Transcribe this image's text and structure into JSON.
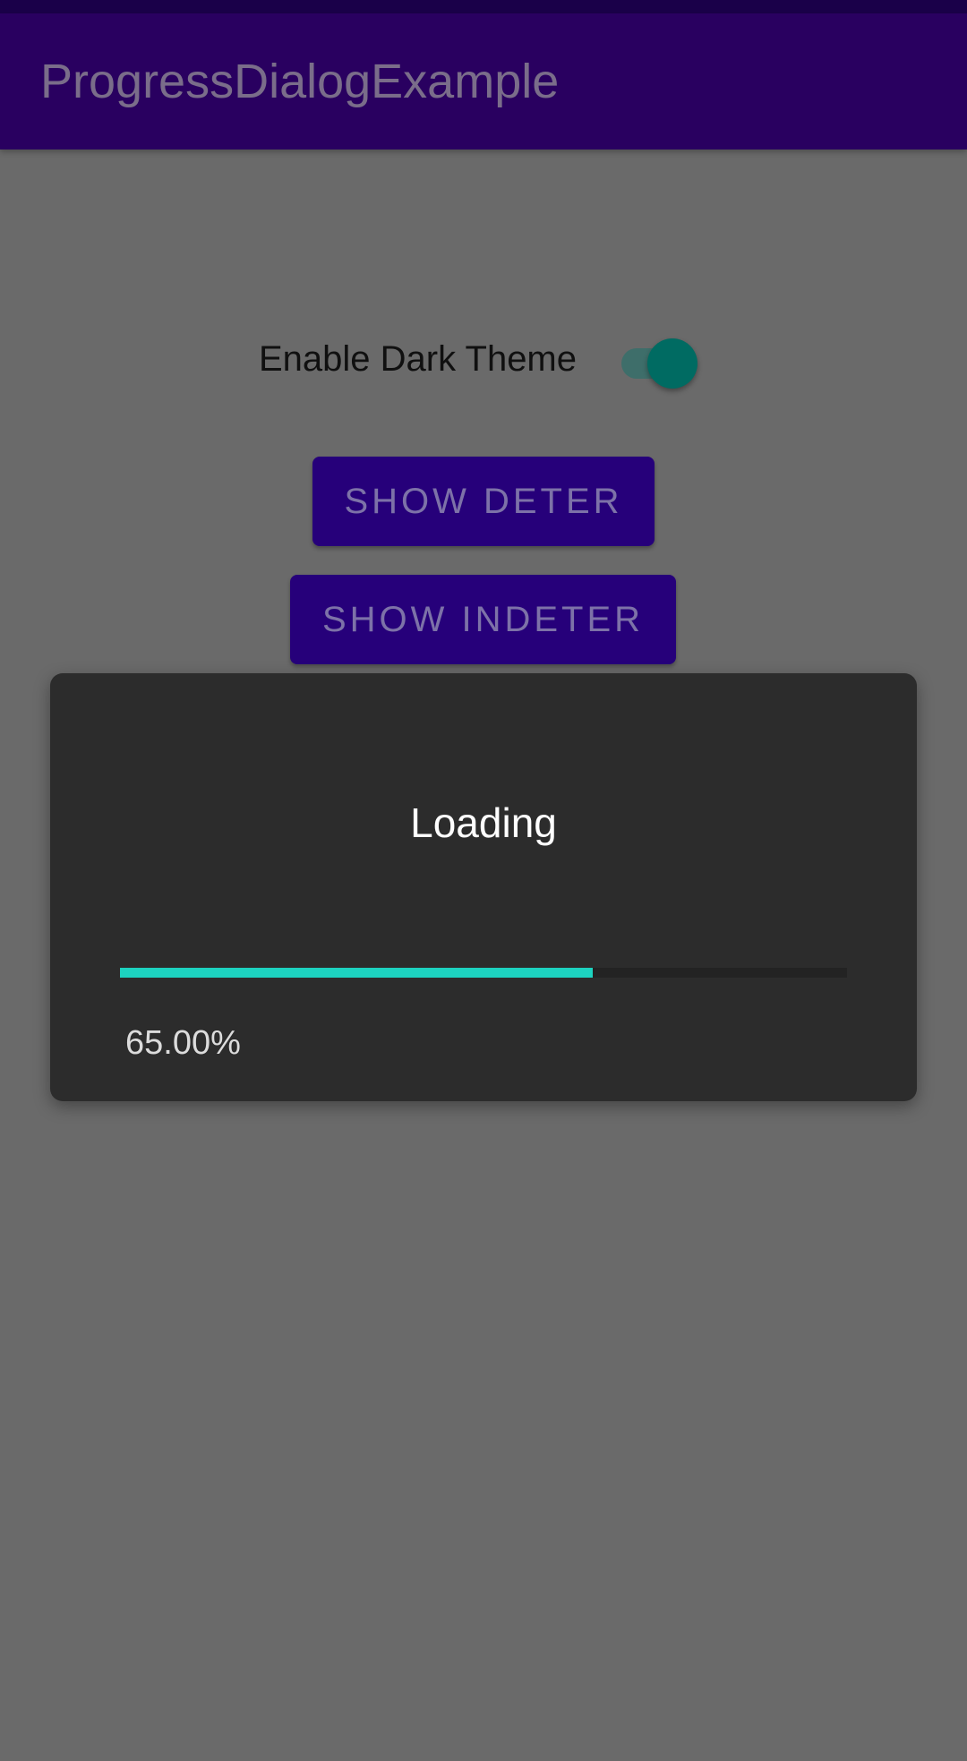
{
  "app_bar": {
    "title": "ProgressDialogExample"
  },
  "settings": {
    "dark_theme_label": "Enable Dark Theme",
    "dark_theme_enabled": true
  },
  "buttons": {
    "show_determinate_label": "SHOW DETER",
    "show_indeterminate_label": "SHOW INDETER"
  },
  "dialog": {
    "title": "Loading",
    "progress_percent_value": 65.0,
    "progress_text": "65.00%"
  },
  "colors": {
    "status_bar": "#1a0049",
    "app_bar": "#290060",
    "button_bg": "#26007a",
    "switch_thumb": "#006b62",
    "progress_fill": "#1dd3c0",
    "dialog_bg": "#2c2c2c",
    "scrim": "#6a6a6a"
  }
}
